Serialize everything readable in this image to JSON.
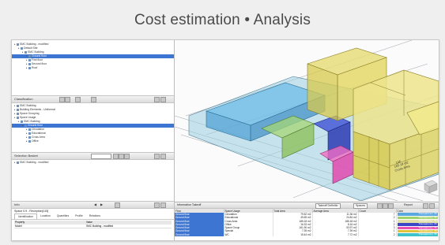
{
  "slide_title": "Cost estimation • Analysis",
  "tree_panel": {
    "rows": [
      {
        "label": "SMC Building - modified",
        "depth": 0,
        "selected": false
      },
      {
        "label": "Default Site",
        "depth": 1,
        "selected": false
      },
      {
        "label": "SMC Building",
        "depth": 2,
        "selected": false
      },
      {
        "label": "Ground floor",
        "depth": 3,
        "selected": true
      },
      {
        "label": "First floor",
        "depth": 3,
        "selected": false
      },
      {
        "label": "Second floor",
        "depth": 3,
        "selected": false
      },
      {
        "label": "Roof",
        "depth": 3,
        "selected": false
      }
    ]
  },
  "classification_panel": {
    "title": "Classification",
    "rows": [
      {
        "label": "SMC Building",
        "depth": 0,
        "selected": false
      },
      {
        "label": "Building Elements - Uniformat",
        "depth": 0,
        "selected": false
      },
      {
        "label": "Space Grouping",
        "depth": 0,
        "selected": false
      },
      {
        "label": "Space Usage",
        "depth": 0,
        "selected": false
      },
      {
        "label": "SMC Building",
        "depth": 1,
        "selected": false
      },
      {
        "label": "Ground floor",
        "depth": 2,
        "selected": true
      },
      {
        "label": "Circulation",
        "depth": 3,
        "selected": false
      },
      {
        "label": "Educational",
        "depth": 3,
        "selected": false
      },
      {
        "label": "Cross Area",
        "depth": 3,
        "selected": false
      },
      {
        "label": "Office",
        "depth": 3,
        "selected": false
      }
    ]
  },
  "selection_basket": {
    "title": "Selection Basket",
    "rows": [
      {
        "label": "SMC Building - modified",
        "depth": 0,
        "selected": false
      }
    ]
  },
  "info_panel": {
    "title": "Info",
    "subtitle": "Space 0.9 - Reception[115]",
    "tabs": [
      "Identification",
      "Location",
      "Quantities",
      "Profile",
      "Relations"
    ],
    "prop_headers": [
      "Property",
      "Value"
    ],
    "props": [
      {
        "name": "Model",
        "value": "SMC Building - modified"
      }
    ]
  },
  "takeoff": {
    "title": "Information Takeoff",
    "toolbar_label": "Takeoff Definitio",
    "spaces_label": "Spaces",
    "report_label": "Report",
    "headers": [
      "Floor",
      "Space Usage",
      "Total Area",
      "Average Area",
      "Count",
      "Color"
    ],
    "rows": [
      {
        "floor": "Ground floor",
        "usage": "Circulation",
        "total": "79.52 m2",
        "avg": "11.36 m2",
        "count": "7",
        "color": "#5aa8e0",
        "color_label": "Transparency: 35"
      },
      {
        "floor": "Ground floor",
        "usage": "Educational",
        "total": "49.69 m2",
        "avg": "24.84 m2",
        "count": "2",
        "color": "#9fd36a",
        "color_label": "Transparency: 35"
      },
      {
        "floor": "Ground floor",
        "usage": "Cross Area",
        "total": "185.18 m2",
        "avg": "185.18 m2",
        "count": "1",
        "color": "#e2e0a6",
        "color_label": "Transparency: 35"
      },
      {
        "floor": "Ground floor",
        "usage": "Office",
        "total": "16.33 m2",
        "avg": "8.16 m2",
        "count": "2",
        "color": "#3b48c8",
        "color_label": "Transparency: 35"
      },
      {
        "floor": "Ground floor",
        "usage": "Space Group",
        "total": "161.90 m2",
        "avg": "53.97 m2",
        "count": "3",
        "color": "#e94fb0",
        "color_label": "Transparency: 35"
      },
      {
        "floor": "Ground floor",
        "usage": "Special",
        "total": "7.39 m2",
        "avg": "7.39 m2",
        "count": "1",
        "color": "#e0c23c",
        "color_label": "Transparency: 35"
      },
      {
        "floor": "Ground floor",
        "usage": "WC",
        "total": "15.44 m2",
        "avg": "7.72 m2",
        "count": "2",
        "color": "#3ec2cc",
        "color_label": "Transparency: 35"
      }
    ]
  },
  "viewport": {
    "label_a": "146",
    "label_b": "185.18 m2",
    "label_c": "Cross Area"
  }
}
